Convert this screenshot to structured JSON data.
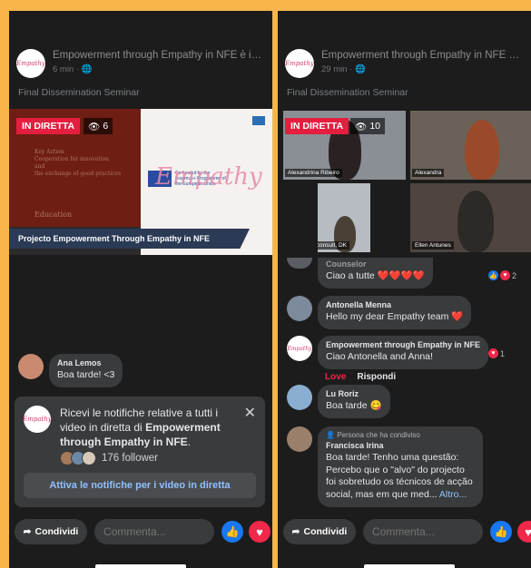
{
  "colors": {
    "frame": "#f7b54c",
    "live": "#e41e3f",
    "like": "#1877f2",
    "love": "#f02849",
    "link": "#8fc1ff"
  },
  "left": {
    "page_title": "Empowerment through Empathy in NFE è in...",
    "time": "6 min",
    "description": "Final Dissemination Seminar",
    "live_label": "IN DIRETTA",
    "viewers": "6",
    "project_banner": "Projecto Empowerment Through Empathy in NFE",
    "slide_text": "Key Action\nCooperation for innovation\nand\nthe exchange of good practices",
    "slide_text2": "Education",
    "cofunded": "Co-funded by the Erasmus+ Programme of the European Union",
    "brand": "Empathy",
    "avatar_text": "Empathy",
    "comment": {
      "name": "Ana Lemos",
      "text": "Boa tarde! <3"
    },
    "notification": {
      "text": "Ricevi le notifiche relative a tutti i video in diretta di ",
      "page": "Empowerment through Empathy in NFE",
      "period": ".",
      "followers": "176 follower",
      "button": "Attiva le notifiche per i video in diretta"
    },
    "share": "Condividi",
    "comment_placeholder": "Commenta..."
  },
  "right": {
    "page_title": "Empowerment through Empathy in NFE è in...",
    "time": "29 min",
    "description": "Final Dissemination Seminar",
    "live_label": "IN DIRETTA",
    "viewers": "10",
    "tiles": [
      "Alexandrina Ribeiro",
      "Alexandra",
      "Jolande, ed-consult, DK",
      "Ellen Antunes"
    ],
    "comments": [
      {
        "name": "Counselor",
        "text": "Ciao a tutte ❤️❤️❤️❤️",
        "reactions": "2"
      },
      {
        "name": "Antonella Menna",
        "text": "Hello my dear Empathy team ❤️"
      },
      {
        "name": "Empowerment through Empathy in NFE",
        "text": "Ciao Antonella and Anna!",
        "reactions": "1",
        "action_love": "Love",
        "action_reply": "Rispondi"
      },
      {
        "name": "Lu Roriz",
        "text": "Boa tarde 😋"
      },
      {
        "tag": "Persona che ha condiviso",
        "name": "Francisca Irina",
        "text": "Boa tarde! Tenho uma questão: Percebo que o \"alvo\" do projecto foi sobretudo os técnicos de acção social, mas em que med...",
        "more": "Altro..."
      }
    ],
    "share": "Condividi",
    "comment_placeholder": "Commenta..."
  }
}
